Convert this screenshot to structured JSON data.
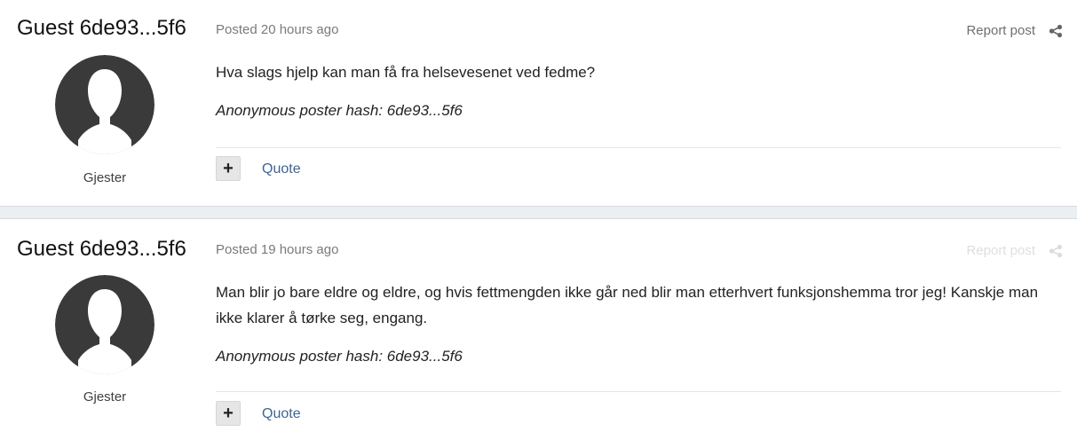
{
  "posts": [
    {
      "author": "Guest 6de93...5f6",
      "group": "Gjester",
      "date": "Posted 20 hours ago",
      "report_label": "Report post",
      "share_icon": "share-icon",
      "body": "Hva slags hjelp kan man få fra helsevesenet ved fedme?",
      "hash": "Anonymous poster hash: 6de93...5f6",
      "rep_label": "+",
      "quote_label": "Quote"
    },
    {
      "author": "Guest 6de93...5f6",
      "group": "Gjester",
      "date": "Posted 19 hours ago",
      "report_label": "Report post",
      "share_icon": "share-icon",
      "body": "Man blir jo bare eldre og eldre, og hvis fettmengden ikke går ned blir man etterhvert funksjonshemma tror jeg! Kanskje man ikke klarer å tørke seg, engang.",
      "hash": "Anonymous poster hash: 6de93...5f6",
      "rep_label": "+",
      "quote_label": "Quote"
    }
  ],
  "colors": {
    "avatar": "#3a3a3a",
    "link": "#3d6594",
    "page_background": "#ebeef2"
  }
}
